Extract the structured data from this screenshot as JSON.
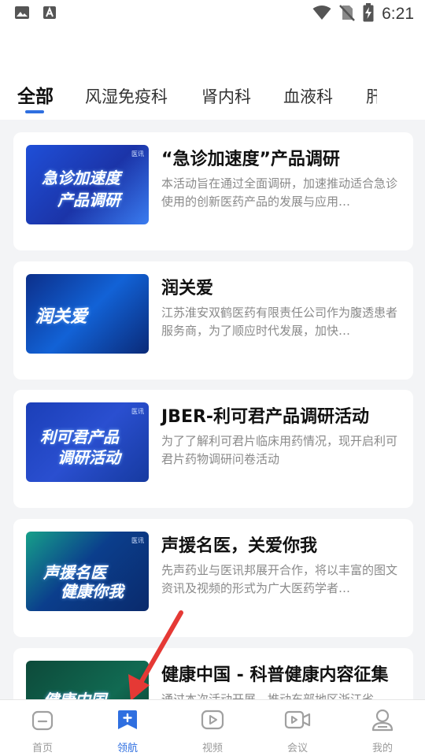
{
  "status_bar": {
    "time": "6:21",
    "icons": [
      "image-icon",
      "text-a-icon",
      "wifi-icon",
      "no-sim-icon",
      "battery-charging-icon"
    ]
  },
  "tabs": [
    {
      "label": "全部",
      "active": true
    },
    {
      "label": "风湿免疫科",
      "active": false
    },
    {
      "label": "肾内科",
      "active": false
    },
    {
      "label": "血液科",
      "active": false
    },
    {
      "label": "肝",
      "active": false
    }
  ],
  "accent_color": "#2f6fe0",
  "cards": [
    {
      "title": "“急诊加速度”产品调研",
      "description": "本活动旨在通过全面调研，加速推动适合急诊使用的创新医药产品的发展与应用…",
      "thumb_line1": "急诊加速度",
      "thumb_line2": "产品调研",
      "thumb_brand": "医讯"
    },
    {
      "title": "润关爱",
      "description": "江苏淮安双鹤医药有限责任公司作为腹透患者服务商，为了顺应时代发展，加快…",
      "thumb_line1": "润关爱",
      "thumb_line2": "",
      "thumb_brand": ""
    },
    {
      "title": "JBER-利可君产品调研活动",
      "description": "为了了解利可君片临床用药情况，现开启利可君片药物调研问卷活动",
      "thumb_line1": "利可君产品",
      "thumb_line2": "调研活动",
      "thumb_brand": "医讯"
    },
    {
      "title": "声援名医，关爱你我",
      "description": "先声药业与医讯邦展开合作，将以丰富的图文资讯及视频的形式为广大医药学者…",
      "thumb_line1": "声援名医",
      "thumb_line2": "健康你我",
      "thumb_brand": "医讯"
    },
    {
      "title": "健康中国 - 科普健康内容征集",
      "description": "通过本次活动开展，推动东部地区浙江省…",
      "thumb_line1": "健康中国",
      "thumb_line2": "",
      "thumb_brand": ""
    }
  ],
  "bottom_nav": [
    {
      "label": "首页",
      "icon": "home-icon",
      "active": false
    },
    {
      "label": "领航",
      "icon": "navigate-plus-icon",
      "active": true
    },
    {
      "label": "视频",
      "icon": "video-play-icon",
      "active": false
    },
    {
      "label": "会议",
      "icon": "meeting-camera-icon",
      "active": false
    },
    {
      "label": "我的",
      "icon": "profile-icon",
      "active": false
    }
  ]
}
